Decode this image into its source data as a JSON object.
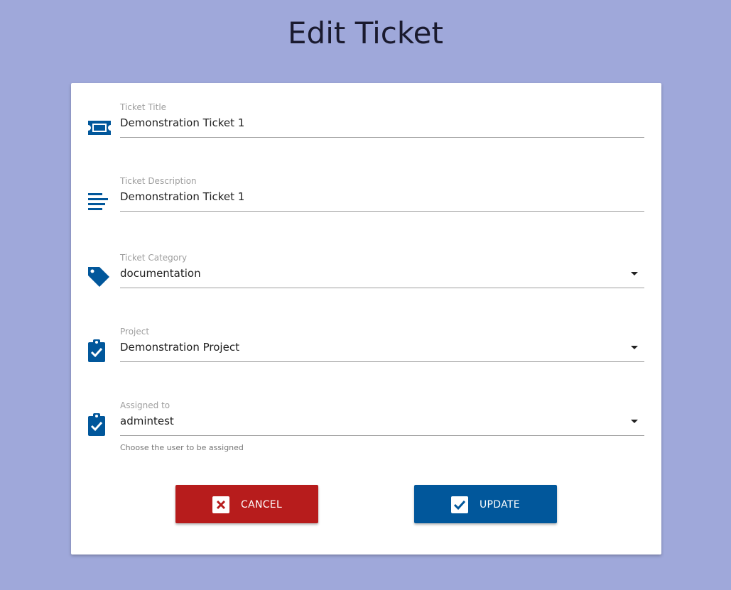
{
  "page": {
    "title": "Edit Ticket"
  },
  "form": {
    "title_field": {
      "label": "Ticket Title",
      "value": "Demonstration Ticket 1",
      "icon": "ticket-icon"
    },
    "description_field": {
      "label": "Ticket Description",
      "value": "Demonstration Ticket 1",
      "icon": "text-lines-icon"
    },
    "category_field": {
      "label": "Ticket Category",
      "value": "documentation",
      "icon": "tag-icon"
    },
    "project_field": {
      "label": "Project",
      "value": "Demonstration Project",
      "icon": "clipboard-check-icon"
    },
    "assigned_field": {
      "label": "Assigned to",
      "value": "admintest",
      "hint": "Choose the user to be assigned",
      "icon": "clipboard-check-icon"
    }
  },
  "actions": {
    "cancel_label": "CANCEL",
    "update_label": "UPDATE"
  },
  "colors": {
    "background": "#9fa8da",
    "primary": "#01579b",
    "danger": "#b71c1c"
  }
}
